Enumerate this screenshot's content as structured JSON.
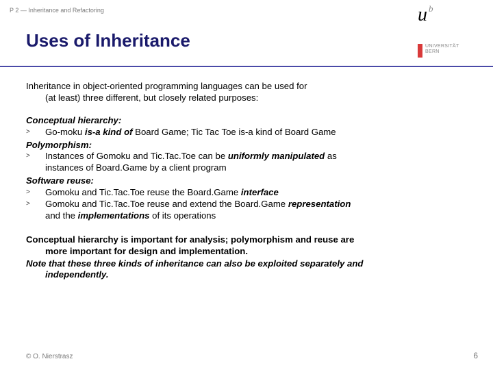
{
  "header": {
    "label": "P 2 — Inheritance and Refactoring"
  },
  "title": "Uses of Inheritance",
  "logo": {
    "uni_line1": "UNIVERSITÄT",
    "uni_line2": "BERN"
  },
  "intro": {
    "l1": "Inheritance in object-oriented programming languages can be used for",
    "l2": "(at least) three different, but closely related purposes:"
  },
  "sections": {
    "conceptual": {
      "heading": "Conceptual hierarchy:",
      "b1_pre": "Go-moku ",
      "b1_em": "is-a kind of",
      "b1_post": " Board Game; Tic Tac Toe is-a kind of Board Game"
    },
    "poly": {
      "heading": "Polymorphism:",
      "b1_pre": "Instances of Gomoku and Tic.Tac.Toe can be ",
      "b1_em": "uniformly manipulated",
      "b1_post": " as",
      "b1_l2": "instances of Board.Game by a client program"
    },
    "reuse": {
      "heading": "Software reuse:",
      "b1_pre": "Gomoku and Tic.Tac.Toe reuse the Board.Game ",
      "b1_em": "interface",
      "b2_pre": "Gomoku and Tic.Tac.Toe reuse and extend the Board.Game ",
      "b2_em": "representation",
      "b2_l2a": "and the ",
      "b2_l2b": "implementations",
      "b2_l2c": " of its operations"
    }
  },
  "closing": {
    "p_l1": "Conceptual hierarchy is important for analysis; polymorphism and reuse are",
    "p_l2": "more important for design and implementation.",
    "n_l1": "Note that these three kinds of inheritance can also be exploited separately and",
    "n_l2": "independently."
  },
  "footer": {
    "left": "© O. Nierstrasz",
    "right": "6"
  },
  "gt": ">"
}
